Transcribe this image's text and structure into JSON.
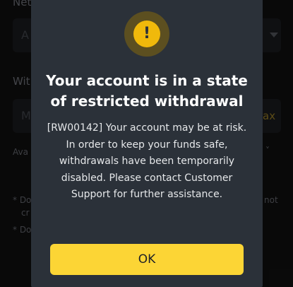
{
  "background": {
    "network_label": "Net",
    "network_field_value": "A",
    "withdraw_label": "Wit",
    "amount_field_value": "M",
    "max_label": "ax",
    "available_label": "Ava",
    "note_line_1": "* Do",
    "note_line_1b": "cr",
    "note_line_1_right": "not",
    "note_line_2": "* Do"
  },
  "dialog": {
    "icon": "exclamation-warning-icon",
    "icon_glyph": "!",
    "title": "Your account is in a state of restricted withdrawal",
    "message": "[RW00142] Your account may be at risk. In order to keep your funds safe, withdrawals have been temporarily disabled. Please contact Customer Support for further assistance.",
    "ok_label": "OK"
  },
  "colors": {
    "accent": "#fcd535",
    "dialog_background": "#2b3139",
    "page_background": "#121212"
  }
}
